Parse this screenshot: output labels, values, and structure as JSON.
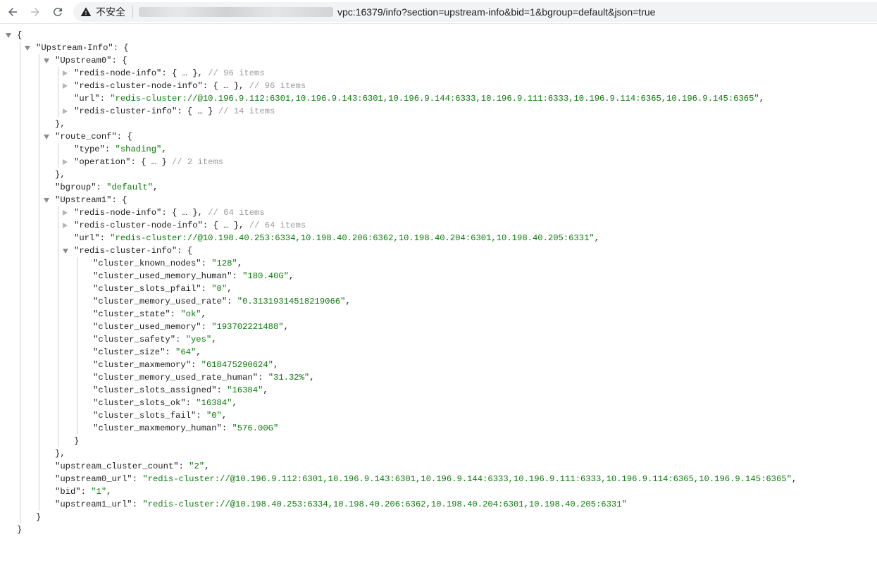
{
  "browser": {
    "security_label": "不安全",
    "url_visible": "vpc:16379/info?section=upstream-info&bid=1&bgroup=default&json=true"
  },
  "json_lines": [
    {
      "depth": 0,
      "toggle": "open",
      "key": "",
      "value": "",
      "open": "{",
      "comment": ""
    },
    {
      "depth": 1,
      "toggle": "open",
      "key": "\"Upstream-Info\"",
      "value": "",
      "open": "{",
      "comment": ""
    },
    {
      "depth": 2,
      "toggle": "open",
      "key": "\"Upstream0\"",
      "value": "",
      "open": "{",
      "comment": ""
    },
    {
      "depth": 3,
      "toggle": "closed",
      "key": "\"redis-node-info\"",
      "value": "",
      "open": "{ … },",
      "comment": "// 96 items"
    },
    {
      "depth": 3,
      "toggle": "closed",
      "key": "\"redis-cluster-node-info\"",
      "value": "",
      "open": "{ … },",
      "comment": "// 96 items"
    },
    {
      "depth": 3,
      "toggle": "none",
      "key": "\"url\"",
      "value": "\"redis-cluster://@10.196.9.112:6301,10.196.9.143:6301,10.196.9.144:6333,10.196.9.111:6333,10.196.9.114:6365,10.196.9.145:6365\"",
      "open": ",",
      "comment": ""
    },
    {
      "depth": 3,
      "toggle": "closed",
      "key": "\"redis-cluster-info\"",
      "value": "",
      "open": "{ … }",
      "comment": "// 14 items"
    },
    {
      "depth": 2,
      "toggle": "none",
      "key": "",
      "value": "",
      "open": "},",
      "comment": ""
    },
    {
      "depth": 2,
      "toggle": "open",
      "key": "\"route_conf\"",
      "value": "",
      "open": "{",
      "comment": ""
    },
    {
      "depth": 3,
      "toggle": "none",
      "key": "\"type\"",
      "value": "\"shading\"",
      "open": ",",
      "comment": ""
    },
    {
      "depth": 3,
      "toggle": "closed",
      "key": "\"operation\"",
      "value": "",
      "open": "{ … }",
      "comment": "// 2 items"
    },
    {
      "depth": 2,
      "toggle": "none",
      "key": "",
      "value": "",
      "open": "},",
      "comment": ""
    },
    {
      "depth": 2,
      "toggle": "none",
      "key": "\"bgroup\"",
      "value": "\"default\"",
      "open": ",",
      "comment": ""
    },
    {
      "depth": 2,
      "toggle": "open",
      "key": "\"Upstream1\"",
      "value": "",
      "open": "{",
      "comment": ""
    },
    {
      "depth": 3,
      "toggle": "closed",
      "key": "\"redis-node-info\"",
      "value": "",
      "open": "{ … },",
      "comment": "// 64 items"
    },
    {
      "depth": 3,
      "toggle": "closed",
      "key": "\"redis-cluster-node-info\"",
      "value": "",
      "open": "{ … },",
      "comment": "// 64 items"
    },
    {
      "depth": 3,
      "toggle": "none",
      "key": "\"url\"",
      "value": "\"redis-cluster://@10.198.40.253:6334,10.198.40.206:6362,10.198.40.204:6301,10.198.40.205:6331\"",
      "open": ",",
      "comment": ""
    },
    {
      "depth": 3,
      "toggle": "open",
      "key": "\"redis-cluster-info\"",
      "value": "",
      "open": "{",
      "comment": ""
    },
    {
      "depth": 4,
      "toggle": "none",
      "key": "\"cluster_known_nodes\"",
      "value": "\"128\"",
      "open": ",",
      "comment": ""
    },
    {
      "depth": 4,
      "toggle": "none",
      "key": "\"cluster_used_memory_human\"",
      "value": "\"180.40G\"",
      "open": ",",
      "comment": ""
    },
    {
      "depth": 4,
      "toggle": "none",
      "key": "\"cluster_slots_pfail\"",
      "value": "\"0\"",
      "open": ",",
      "comment": ""
    },
    {
      "depth": 4,
      "toggle": "none",
      "key": "\"cluster_memory_used_rate\"",
      "value": "\"0.31319314518219066\"",
      "open": ",",
      "comment": ""
    },
    {
      "depth": 4,
      "toggle": "none",
      "key": "\"cluster_state\"",
      "value": "\"ok\"",
      "open": ",",
      "comment": ""
    },
    {
      "depth": 4,
      "toggle": "none",
      "key": "\"cluster_used_memory\"",
      "value": "\"193702221488\"",
      "open": ",",
      "comment": ""
    },
    {
      "depth": 4,
      "toggle": "none",
      "key": "\"cluster_safety\"",
      "value": "\"yes\"",
      "open": ",",
      "comment": ""
    },
    {
      "depth": 4,
      "toggle": "none",
      "key": "\"cluster_size\"",
      "value": "\"64\"",
      "open": ",",
      "comment": ""
    },
    {
      "depth": 4,
      "toggle": "none",
      "key": "\"cluster_maxmemory\"",
      "value": "\"618475290624\"",
      "open": ",",
      "comment": ""
    },
    {
      "depth": 4,
      "toggle": "none",
      "key": "\"cluster_memory_used_rate_human\"",
      "value": "\"31.32%\"",
      "open": ",",
      "comment": ""
    },
    {
      "depth": 4,
      "toggle": "none",
      "key": "\"cluster_slots_assigned\"",
      "value": "\"16384\"",
      "open": ",",
      "comment": ""
    },
    {
      "depth": 4,
      "toggle": "none",
      "key": "\"cluster_slots_ok\"",
      "value": "\"16384\"",
      "open": ",",
      "comment": ""
    },
    {
      "depth": 4,
      "toggle": "none",
      "key": "\"cluster_slots_fail\"",
      "value": "\"0\"",
      "open": ",",
      "comment": ""
    },
    {
      "depth": 4,
      "toggle": "none",
      "key": "\"cluster_maxmemory_human\"",
      "value": "\"576.00G\"",
      "open": "",
      "comment": ""
    },
    {
      "depth": 3,
      "toggle": "none",
      "key": "",
      "value": "",
      "open": "}",
      "comment": ""
    },
    {
      "depth": 2,
      "toggle": "none",
      "key": "",
      "value": "",
      "open": "},",
      "comment": ""
    },
    {
      "depth": 2,
      "toggle": "none",
      "key": "\"upstream_cluster_count\"",
      "value": "\"2\"",
      "open": ",",
      "comment": ""
    },
    {
      "depth": 2,
      "toggle": "none",
      "key": "\"upstream0_url\"",
      "value": "\"redis-cluster://@10.196.9.112:6301,10.196.9.143:6301,10.196.9.144:6333,10.196.9.111:6333,10.196.9.114:6365,10.196.9.145:6365\"",
      "open": ",",
      "comment": ""
    },
    {
      "depth": 2,
      "toggle": "none",
      "key": "\"bid\"",
      "value": "\"1\"",
      "open": ",",
      "comment": ""
    },
    {
      "depth": 2,
      "toggle": "none",
      "key": "\"upstream1_url\"",
      "value": "\"redis-cluster://@10.198.40.253:6334,10.198.40.206:6362,10.198.40.204:6301,10.198.40.205:6331\"",
      "open": "",
      "comment": ""
    },
    {
      "depth": 1,
      "toggle": "none",
      "key": "",
      "value": "",
      "open": "}",
      "comment": ""
    },
    {
      "depth": 0,
      "toggle": "none",
      "key": "",
      "value": "",
      "open": "}",
      "comment": ""
    }
  ]
}
